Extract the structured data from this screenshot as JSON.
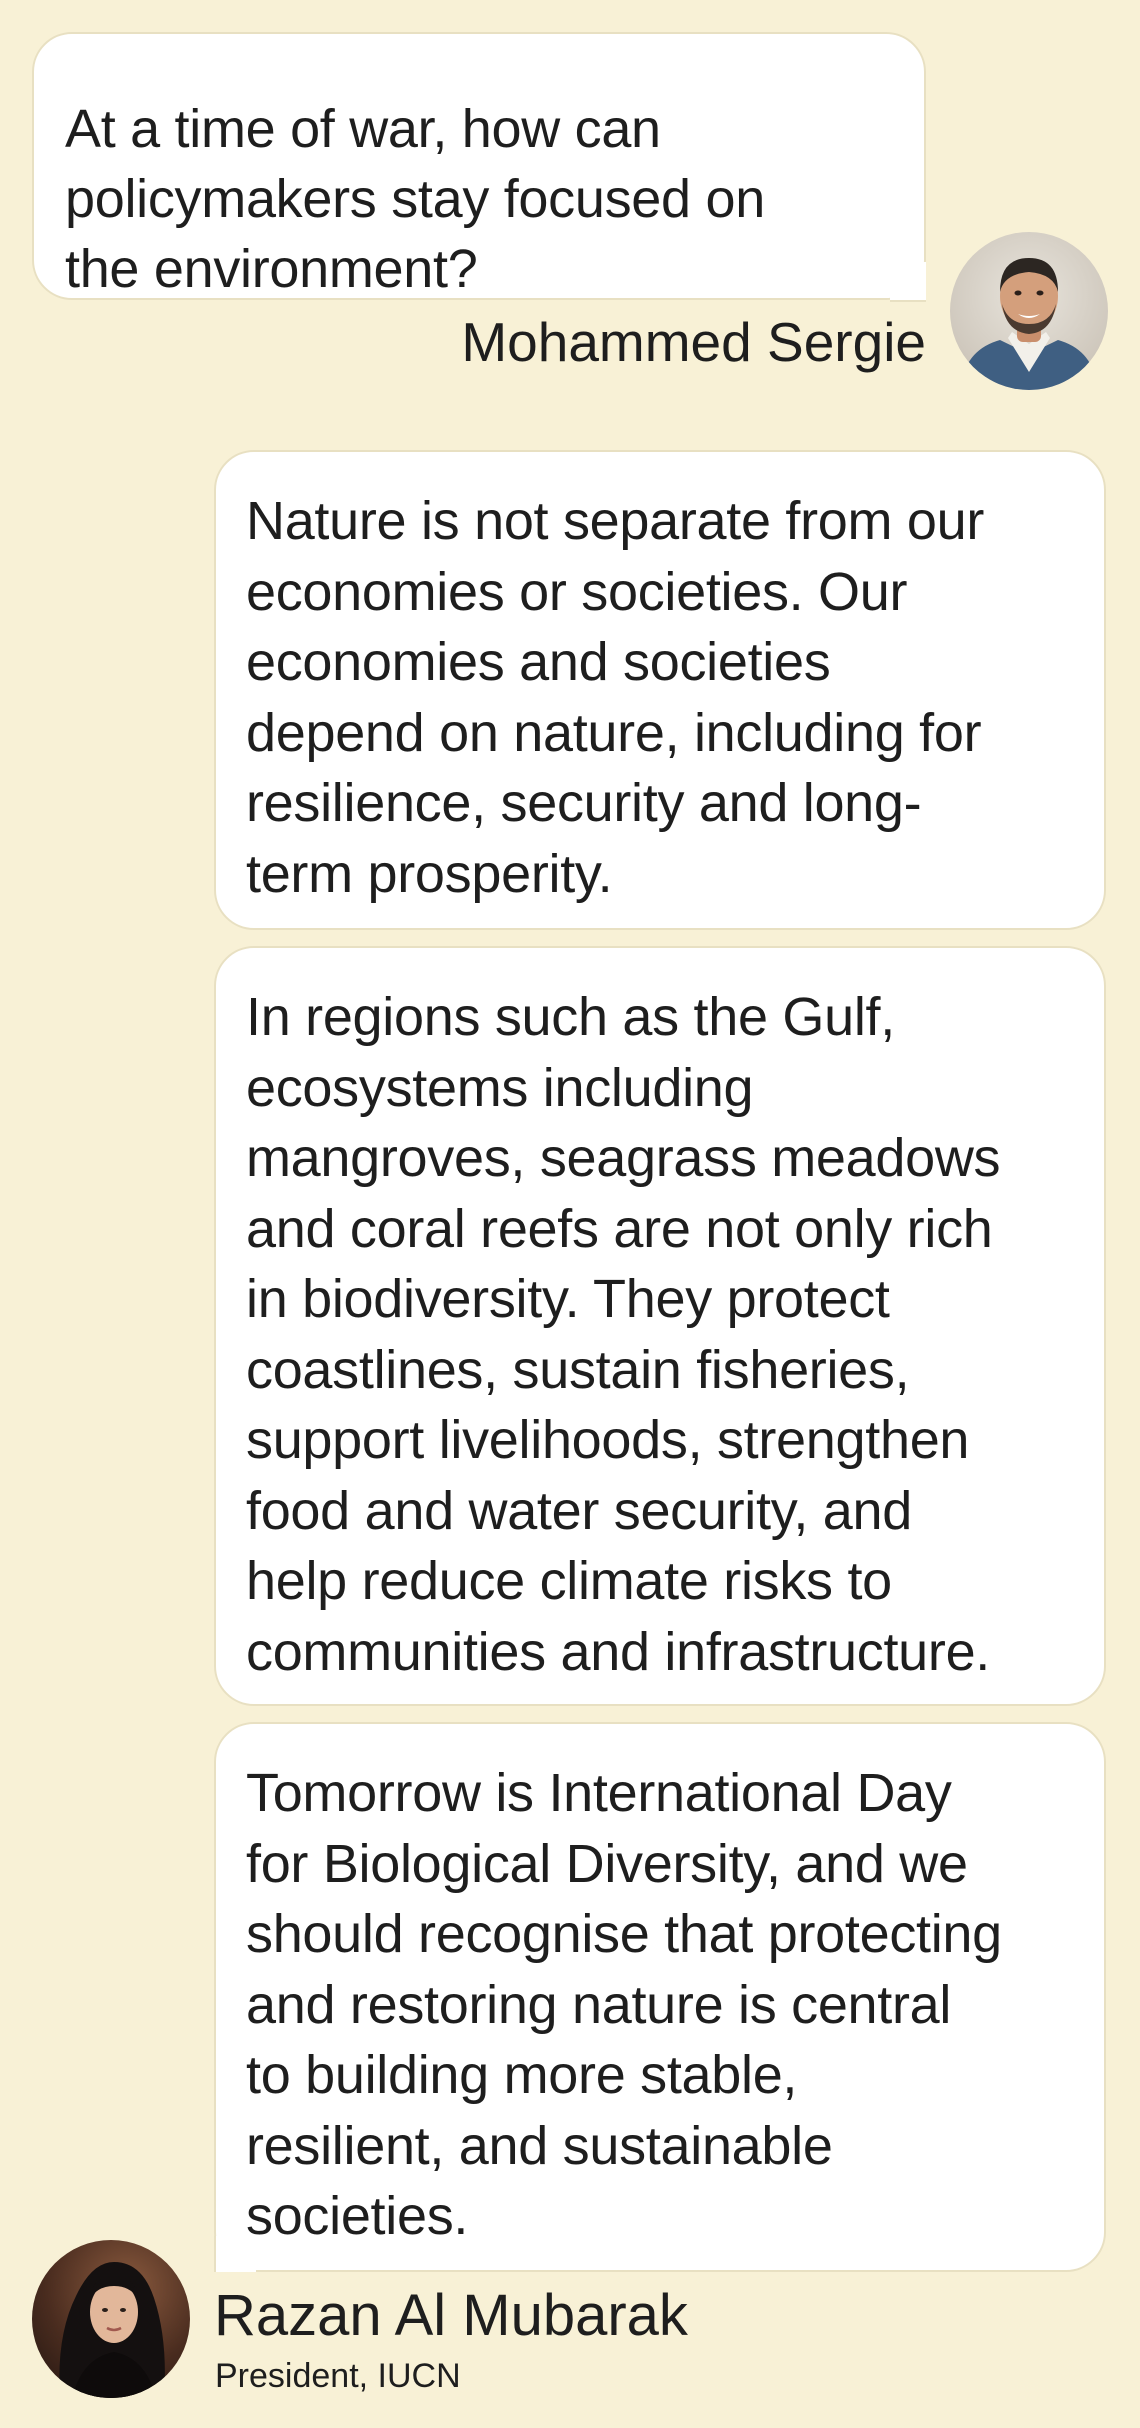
{
  "conversation": {
    "question": {
      "text": "At a time of war, how can\npolicymakers stay focused on\nthe environment?",
      "author": "Mohammed Sergie"
    },
    "answers": [
      {
        "text": "Nature is not separate from our\neconomies or societies. Our\neconomies and societies\ndepend on nature, including for\nresilience, security and long-\nterm prosperity."
      },
      {
        "text": "In regions such as the Gulf,\necosystems including\nmangroves, seagrass meadows\nand coral reefs are not only rich\nin biodiversity. They protect\ncoastlines, sustain fisheries,\nsupport livelihoods, strengthen\nfood and water security, and\nhelp reduce climate risks to\ncommunities and infrastructure."
      },
      {
        "text": "Tomorrow is International Day\nfor Biological Diversity, and we\nshould recognise that protecting\nand restoring nature is central\nto building more stable,\nresilient, and sustainable\nsocieties."
      }
    ],
    "responder": {
      "name": "Razan Al Mubarak",
      "title": "President, IUCN"
    }
  },
  "colors": {
    "background": "#f8f1d6",
    "bubble": "#ffffff",
    "bubble_border": "#e8e0c2",
    "text": "#1e1e1e"
  }
}
